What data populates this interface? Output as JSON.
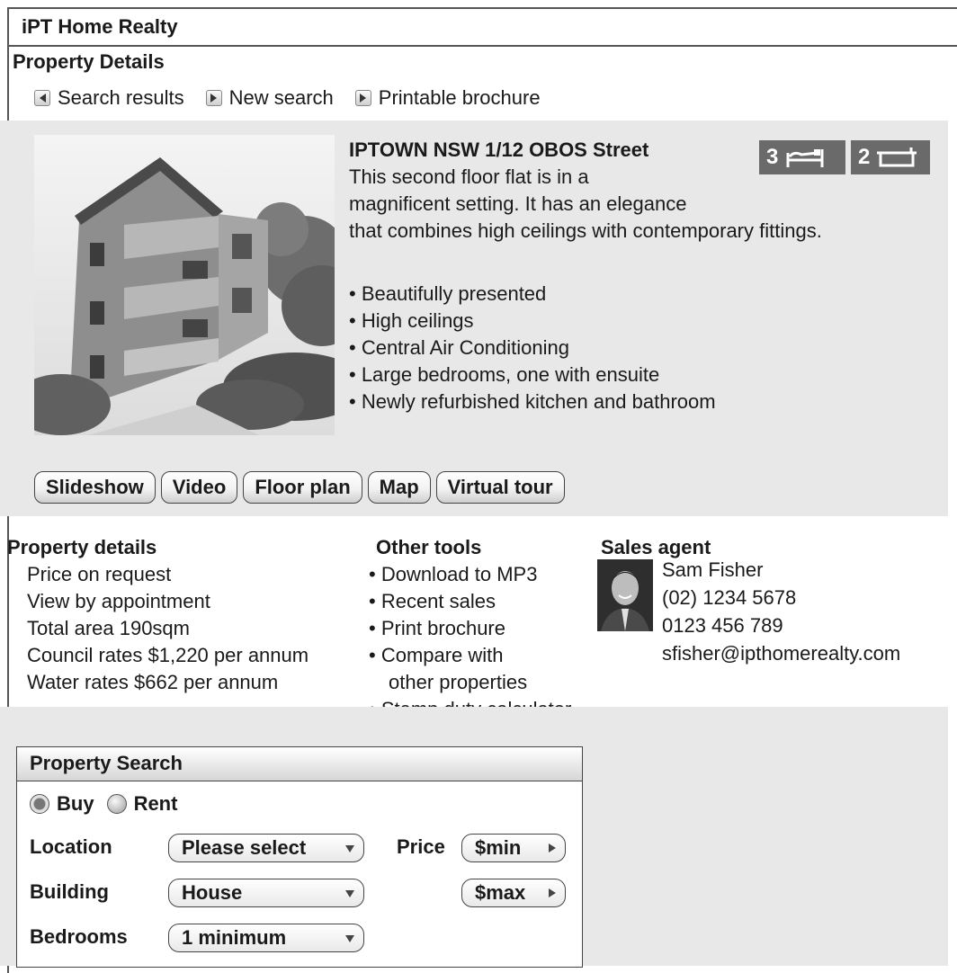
{
  "app": {
    "title": "iPT Home Realty"
  },
  "page": {
    "section_title": "Property Details"
  },
  "nav": [
    {
      "label": "Search results",
      "icon": "arrow-left-icon"
    },
    {
      "label": "New search",
      "icon": "arrow-right-icon"
    },
    {
      "label": "Printable brochure",
      "icon": "arrow-right-icon"
    }
  ],
  "listing": {
    "address": "IPTOWN NSW 1/12 OBOS Street",
    "description_lines": [
      "This second floor flat is in a",
      "magnificent setting. It has an elegance",
      "that combines high ceilings with contemporary fittings."
    ],
    "features": [
      "• Beautifully presented",
      "• High ceilings",
      "• Central Air Conditioning",
      "• Large bedrooms, one with ensuite",
      "• Newly refurbished kitchen and bathroom"
    ],
    "bedrooms": "3",
    "bathrooms": "2",
    "bedroom_icon": "bed-icon",
    "bathroom_icon": "bathtub-icon"
  },
  "media_buttons": [
    "Slideshow",
    "Video",
    "Floor plan",
    "Map",
    "Virtual tour"
  ],
  "property_details": {
    "title": "Property details",
    "items": [
      "Price on request",
      "View by appointment",
      "Total area 190sqm",
      "Council rates $1,220 per annum",
      "Water rates $662 per annum"
    ]
  },
  "other_tools": {
    "title": "Other tools",
    "items": [
      "• Download to MP3",
      "• Recent sales",
      "• Print brochure",
      "• Compare with",
      "other properties",
      "• Stamp duty calculator"
    ]
  },
  "sales_agent": {
    "title": "Sales agent",
    "name": "Sam Fisher",
    "phone": "(02) 1234 5678",
    "mobile": "0123 456 789",
    "email": "sfisher@ipthomerealty.com"
  },
  "search": {
    "title": "Property Search",
    "radio_buy": "Buy",
    "radio_rent": "Rent",
    "selected": "Buy",
    "location_label": "Location",
    "location_value": "Please select",
    "building_label": "Building",
    "building_value": "House",
    "bedrooms_label": "Bedrooms",
    "bedrooms_value": "1 minimum",
    "price_label": "Price",
    "price_min": "$min",
    "price_max": "$max"
  },
  "colors": {
    "panel_grey": "#e8e8e8",
    "badge_grey": "#6a6a6a",
    "border": "#555555"
  }
}
